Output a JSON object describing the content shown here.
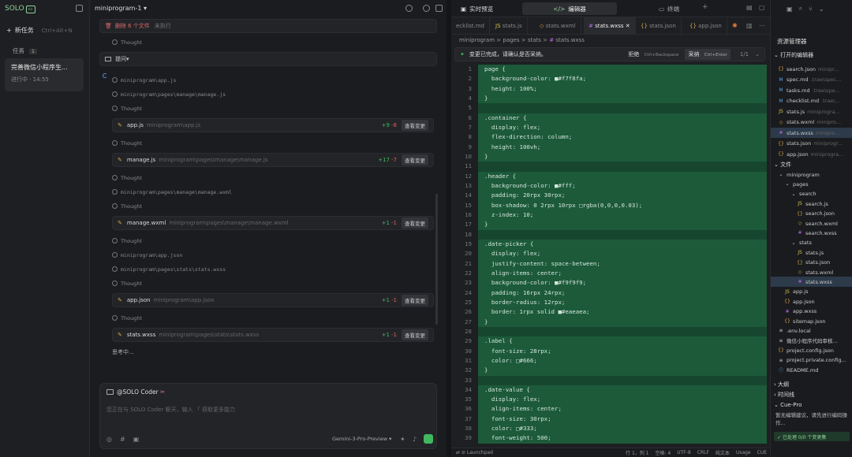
{
  "sidebar": {
    "logo": "SOLO",
    "new_task": "新任务",
    "new_task_shortcut": "Ctrl+Alt+N",
    "tasks_label": "任务",
    "tasks_count": "1",
    "task_title": "完善微信小程序生...",
    "task_status": "进行中 · 14:55"
  },
  "chat": {
    "project": "miniprogram-1",
    "deleted": "删除 6 个文件",
    "deleted_status": "未执行",
    "thought": "Thought",
    "ask": "提问",
    "paths": {
      "app_js": "miniprogram\\app.js",
      "manage_js": "miniprogram\\pages\\manage\\manage.js",
      "manage_wxml": "miniprogram\\pages\\manage\\manage.wxml",
      "app_json": "miniprogram\\app.json",
      "stats_wxss": "miniprogram\\pages\\stats\\stats.wxss"
    },
    "files": [
      {
        "name": "app.js",
        "path": "miniprogram\\app.js",
        "plus": "+9",
        "minus": "-8"
      },
      {
        "name": "manage.js",
        "path": "miniprogram\\pages\\manage\\manage.js",
        "plus": "+17",
        "minus": "-7"
      },
      {
        "name": "manage.wxml",
        "path": "miniprogram\\pages\\manage\\manage.wxml",
        "plus": "+1",
        "minus": "-1"
      },
      {
        "name": "app.json",
        "path": "miniprogram\\app.json",
        "plus": "+1",
        "minus": "-1"
      },
      {
        "name": "stats.wxss",
        "path": "miniprogram\\pages\\stats\\stats.wxss",
        "plus": "+1",
        "minus": "-1"
      }
    ],
    "view_changes": "查看变更",
    "thinking": "思考中...",
    "input": {
      "mention": "@SOLO Coder",
      "placeholder": "您正在与 SOLO Coder 聊天，输入 「 获取更多能力",
      "model": "Gemini-3-Pro-Preview"
    }
  },
  "editor": {
    "tabs": {
      "browser": "实时预览",
      "editor": "编辑器",
      "terminal": "终端"
    },
    "file_tabs": [
      "ecklist.md",
      "stats.js",
      "stats.wxml",
      "stats.wxss",
      "stats.json",
      "app.json"
    ],
    "breadcrumb": [
      "miniprogram",
      ">",
      "pages",
      ">",
      "stats",
      ">",
      "stats.wxss"
    ],
    "banner": {
      "text": "变更已完成，请确认是否采纳。",
      "reject": "拒绝",
      "reject_key": "Ctrl+Backspace",
      "accept": "采纳",
      "accept_key": "Ctrl+Enter",
      "counter": "1/1"
    },
    "code": [
      "page {",
      "  background-color: ■#f7f8fa;",
      "  height: 100%;",
      "}",
      "",
      ".container {",
      "  display: flex;",
      "  flex-direction: column;",
      "  height: 100vh;",
      "}",
      "",
      ".header {",
      "  background-color: ■#fff;",
      "  padding: 20rpx 30rpx;",
      "  box-shadow: 0 2rpx 10rpx □rgba(0,0,0,0.03);",
      "  z-index: 10;",
      "}",
      "",
      ".date-picker {",
      "  display: flex;",
      "  justify-content: space-between;",
      "  align-items: center;",
      "  background-color: ■#f9f9f9;",
      "  padding: 16rpx 24rpx;",
      "  border-radius: 12rpx;",
      "  border: 1rpx solid ■#eaeaea;",
      "}",
      "",
      ".label {",
      "  font-size: 28rpx;",
      "  color: □#666;",
      "}",
      "",
      ".date-value {",
      "  display: flex;",
      "  align-items: center;",
      "  font-size: 30rpx;",
      "  color: □#333;",
      "  font-weight: 500;"
    ],
    "status": {
      "launchpad": "Launchpad",
      "pos": "行 1，列 1",
      "spaces": "空格: 4",
      "enc": "UTF-8",
      "eol": "CRLF",
      "lang": "纯文本",
      "usage": "Usage",
      "cue": "CUE"
    }
  },
  "explorer": {
    "title": "资源管理器",
    "open_editors": "打开的编辑器",
    "open": [
      {
        "i": "{}",
        "n": "search.json",
        "p": "minipr..."
      },
      {
        "i": "M",
        "n": "spec.md",
        "p": ".trae\\spec..."
      },
      {
        "i": "M",
        "n": "tasks.md",
        "p": ".trae\\spe..."
      },
      {
        "i": "M",
        "n": "checklist.md",
        "p": ".trae\\..."
      },
      {
        "i": "JS",
        "n": "stats.js",
        "p": "miniprogra..."
      },
      {
        "i": "◇",
        "n": "stats.wxml",
        "p": "minipro..."
      },
      {
        "i": "#",
        "n": "stats.wxss",
        "p": "minipro..."
      },
      {
        "i": "{}",
        "n": "stats.json",
        "p": "miniprogr..."
      },
      {
        "i": "{}",
        "n": "app.json",
        "p": "miniprogra..."
      }
    ],
    "files_h": "文件",
    "tree": [
      "miniprogram",
      "pages",
      "search",
      "search.js",
      "search.json",
      "search.wxml",
      "search.wxss",
      "stats",
      "stats.js",
      "stats.json",
      "stats.wxml",
      "stats.wxss",
      "app.js",
      "app.json",
      "app.wxss",
      "sitemap.json",
      ".env.local",
      "微信小程序代码审核...",
      "project.config.json",
      "project.private.config...",
      "README.md"
    ],
    "outline": "大纲",
    "timeline": "时间线",
    "cue_title": "Cue-Pro",
    "cue_msg": "暂无编辑建议，请先进行编码操作...",
    "cue_status": "已处理 0/0 个变更集"
  }
}
